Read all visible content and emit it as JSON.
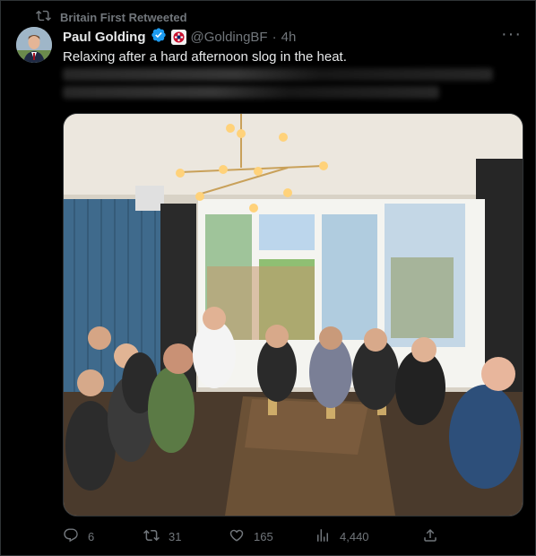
{
  "retweet_bar": {
    "label": "Britain First Retweeted"
  },
  "author": {
    "name": "Paul Golding",
    "handle": "@GoldingBF",
    "separator": "·",
    "time": "4h"
  },
  "tweet": {
    "text": "Relaxing after a hard afternoon slog in the heat."
  },
  "actions": {
    "replies": "6",
    "retweets": "31",
    "likes": "165",
    "views": "4,440"
  },
  "colors": {
    "background": "#000000",
    "text": "#e7e9ea",
    "muted": "#71767b",
    "verified": "#1d9bf0",
    "border": "#2f3336"
  },
  "icons": [
    "retweet-icon",
    "verified-icon",
    "more-icon",
    "reply-icon",
    "like-icon",
    "views-icon",
    "share-icon"
  ]
}
